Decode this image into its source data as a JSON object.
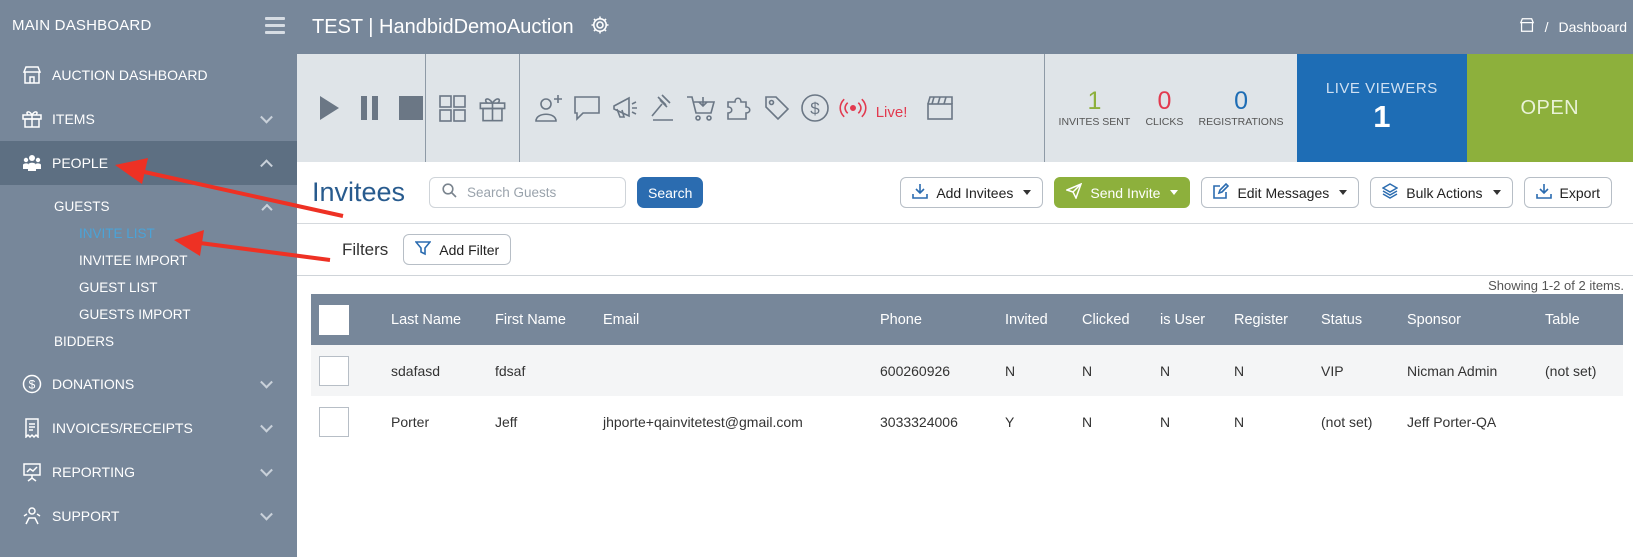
{
  "sidebar": {
    "title": "MAIN DASHBOARD",
    "items": [
      {
        "label": "AUCTION DASHBOARD"
      },
      {
        "label": "ITEMS"
      },
      {
        "label": "PEOPLE"
      },
      {
        "label": "DONATIONS"
      },
      {
        "label": "INVOICES/RECEIPTS"
      },
      {
        "label": "REPORTING"
      },
      {
        "label": "SUPPORT"
      }
    ],
    "guests": {
      "label": "GUESTS",
      "children": [
        "INVITE LIST",
        "INVITEE IMPORT",
        "GUEST LIST",
        "GUESTS IMPORT"
      ]
    },
    "bidders_label": "BIDDERS"
  },
  "header": {
    "title": "TEST | HandbidDemoAuction",
    "breadcrumb_sep": "/",
    "breadcrumb": "Dashboard"
  },
  "toolbar": {
    "live_label": "Live!",
    "stats": [
      {
        "value": "1",
        "label": "INVITES SENT",
        "color": "#8db03c"
      },
      {
        "value": "0",
        "label": "CLICKS",
        "color": "#e23a4f"
      },
      {
        "value": "0",
        "label": "REGISTRATIONS",
        "color": "#1e6db5"
      }
    ],
    "viewers_label": "LIVE VIEWERS",
    "viewers_count": "1",
    "status": "OPEN"
  },
  "invitees": {
    "title": "Invitees",
    "search_placeholder": "Search Guests",
    "search_button": "Search",
    "actions": {
      "add_invitees": "Add Invitees",
      "send_invite": "Send Invite",
      "edit_messages": "Edit Messages",
      "bulk_actions": "Bulk Actions",
      "export": "Export"
    },
    "filters_label": "Filters",
    "add_filter": "Add Filter",
    "showing": "Showing 1-2 of 2 items."
  },
  "table": {
    "columns": [
      "Last Name",
      "First Name",
      "Email",
      "Phone",
      "Invited",
      "Clicked",
      "is User",
      "Register",
      "Status",
      "Sponsor",
      "Table"
    ],
    "rows": [
      {
        "last": "sdafasd",
        "first": "fdsaf",
        "email": "",
        "phone": "600260926",
        "invited": "N",
        "clicked": "N",
        "is_user": "N",
        "register": "N",
        "status": "VIP",
        "sponsor": "Nicman Admin",
        "table": "(not set)"
      },
      {
        "last": "Porter",
        "first": "Jeff",
        "email": "jhporte+qainvitetest@gmail.com",
        "phone": "3033324006",
        "invited": "Y",
        "clicked": "N",
        "is_user": "N",
        "register": "N",
        "status": "(not set)",
        "sponsor": "Jeff Porter-QA",
        "table": ""
      }
    ]
  },
  "colors": {
    "sidebar_bg": "#77879a",
    "accent_blue": "#1e6db5",
    "accent_green": "#8db03c",
    "annotation_red": "#ee3124"
  }
}
